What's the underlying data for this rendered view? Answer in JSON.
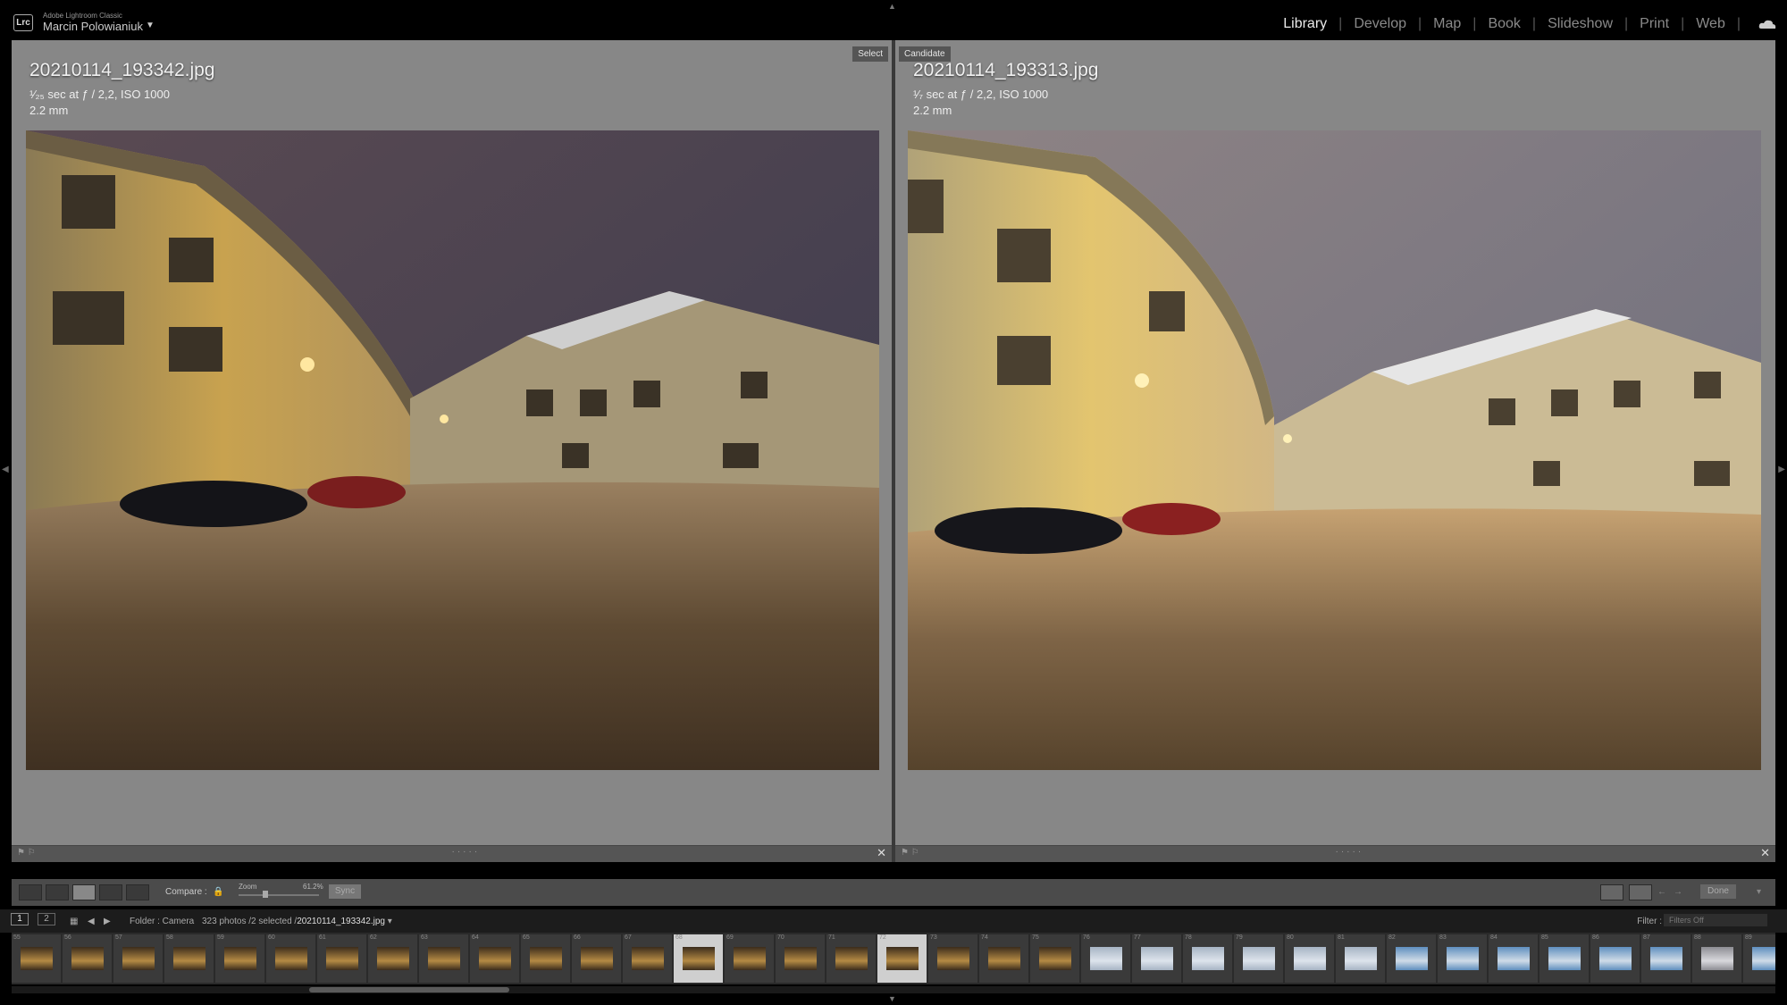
{
  "app": {
    "name": "Adobe Lightroom Classic",
    "logo": "Lrc",
    "user": "Marcin Polowianiuk"
  },
  "modules": [
    {
      "label": "Library",
      "active": true
    },
    {
      "label": "Develop",
      "active": false
    },
    {
      "label": "Map",
      "active": false
    },
    {
      "label": "Book",
      "active": false
    },
    {
      "label": "Slideshow",
      "active": false
    },
    {
      "label": "Print",
      "active": false
    },
    {
      "label": "Web",
      "active": false
    }
  ],
  "compare": {
    "select": {
      "tag": "Select",
      "filename": "20210114_193342.jpg",
      "exif_line1": "¹⁄₂₅ sec at ƒ / 2,2, ISO 1000",
      "exif_line2": "2.2 mm"
    },
    "candidate": {
      "tag": "Candidate",
      "filename": "20210114_193313.jpg",
      "exif_line1": "¹⁄₇ sec at ƒ / 2,2, ISO 1000",
      "exif_line2": "2.2 mm"
    }
  },
  "toolbar": {
    "compare_label": "Compare :",
    "zoom_label": "Zoom",
    "zoom_value": "61.2%",
    "zoom_level_pct": 61.2,
    "sync_label": "Sync",
    "done_label": "Done"
  },
  "filmstrip_header": {
    "page1": "1",
    "page2": "2",
    "folder": "Folder : Camera",
    "count": "323 photos /2 selected /",
    "current_file": "20210114_193342.jpg",
    "filter_label": "Filter :",
    "filter_value": "Filters Off"
  },
  "filmstrip": {
    "thumbs": [
      {
        "n": "55",
        "kind": "night"
      },
      {
        "n": "56",
        "kind": "night"
      },
      {
        "n": "57",
        "kind": "night"
      },
      {
        "n": "58",
        "kind": "night"
      },
      {
        "n": "59",
        "kind": "night"
      },
      {
        "n": "60",
        "kind": "night"
      },
      {
        "n": "61",
        "kind": "night"
      },
      {
        "n": "62",
        "kind": "night"
      },
      {
        "n": "63",
        "kind": "night"
      },
      {
        "n": "64",
        "kind": "night"
      },
      {
        "n": "65",
        "kind": "night"
      },
      {
        "n": "66",
        "kind": "night"
      },
      {
        "n": "67",
        "kind": "night"
      },
      {
        "n": "68",
        "kind": "night",
        "selected": true
      },
      {
        "n": "69",
        "kind": "night"
      },
      {
        "n": "70",
        "kind": "night"
      },
      {
        "n": "71",
        "kind": "night"
      },
      {
        "n": "72",
        "kind": "night",
        "selected": true
      },
      {
        "n": "73",
        "kind": "night"
      },
      {
        "n": "74",
        "kind": "night"
      },
      {
        "n": "75",
        "kind": "night"
      },
      {
        "n": "76",
        "kind": "snow"
      },
      {
        "n": "77",
        "kind": "snow"
      },
      {
        "n": "78",
        "kind": "snow"
      },
      {
        "n": "79",
        "kind": "snow"
      },
      {
        "n": "80",
        "kind": "snow"
      },
      {
        "n": "81",
        "kind": "snow"
      },
      {
        "n": "82",
        "kind": "blue"
      },
      {
        "n": "83",
        "kind": "blue"
      },
      {
        "n": "84",
        "kind": "blue"
      },
      {
        "n": "85",
        "kind": "blue"
      },
      {
        "n": "86",
        "kind": "blue"
      },
      {
        "n": "87",
        "kind": "blue"
      },
      {
        "n": "88",
        "kind": "tree"
      },
      {
        "n": "89",
        "kind": "blue"
      }
    ]
  }
}
